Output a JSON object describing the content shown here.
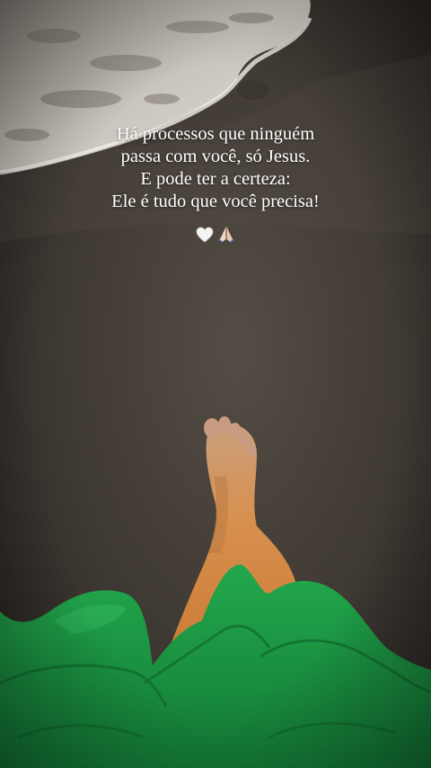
{
  "story": {
    "caption_lines": [
      "Há processos que ninguém",
      "passa com você, só Jesus.",
      "E pode ter a certeza:",
      "Ele é tudo que você precisa!"
    ],
    "emojis": [
      "white-heart-icon",
      "praying-hands-icon"
    ]
  },
  "colors": {
    "sand_dark": "#2e2b27",
    "sand_mid": "#4a443d",
    "foam": "#d9d6cf",
    "skin": "#d08a4f",
    "dress_green": "#1a9a45",
    "caption_text": "#ffffff"
  }
}
